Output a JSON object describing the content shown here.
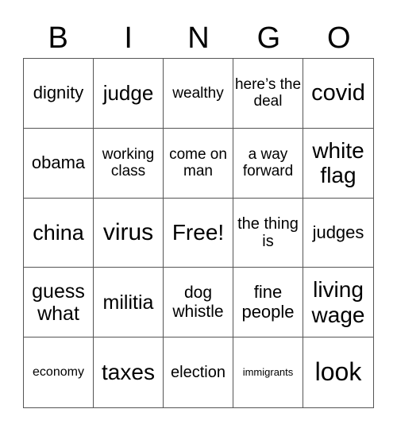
{
  "header": {
    "letters": [
      "B",
      "I",
      "N",
      "G",
      "O"
    ]
  },
  "grid": {
    "rows": [
      [
        {
          "text": "dignity",
          "size": 22
        },
        {
          "text": "judge",
          "size": 26
        },
        {
          "text": "wealthy",
          "size": 19
        },
        {
          "text": "here’s the deal",
          "size": 19
        },
        {
          "text": "covid",
          "size": 29
        }
      ],
      [
        {
          "text": "obama",
          "size": 22
        },
        {
          "text": "working class",
          "size": 19
        },
        {
          "text": "come on man",
          "size": 19
        },
        {
          "text": "a way forward",
          "size": 19
        },
        {
          "text": "white flag",
          "size": 28
        }
      ],
      [
        {
          "text": "china",
          "size": 27
        },
        {
          "text": "virus",
          "size": 30
        },
        {
          "text": "Free!",
          "size": 28
        },
        {
          "text": "the thing is",
          "size": 20
        },
        {
          "text": "judges",
          "size": 22
        }
      ],
      [
        {
          "text": "guess what",
          "size": 25
        },
        {
          "text": "militia",
          "size": 25
        },
        {
          "text": "dog whistle",
          "size": 21
        },
        {
          "text": "fine people",
          "size": 22
        },
        {
          "text": "living wage",
          "size": 28
        }
      ],
      [
        {
          "text": "economy",
          "size": 16
        },
        {
          "text": "taxes",
          "size": 28
        },
        {
          "text": "election",
          "size": 20
        },
        {
          "text": "immigrants",
          "size": 13
        },
        {
          "text": "look",
          "size": 32
        }
      ]
    ]
  }
}
